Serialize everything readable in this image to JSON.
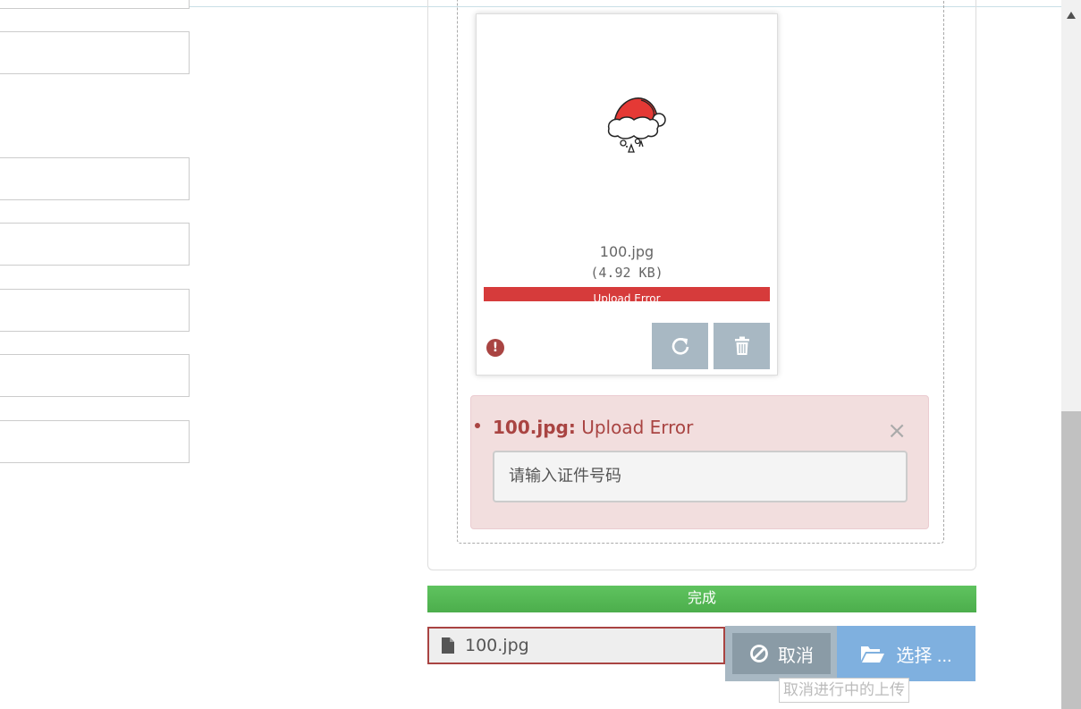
{
  "thumbnail": {
    "file_name": "100.jpg",
    "file_size": "(4.92 KB)",
    "progress_label": "Upload Error",
    "progress": 1.0,
    "image_icon": "santa-hat-icon",
    "retry_icon": "refresh-icon",
    "delete_icon": "trash-icon",
    "status_icon": "exclamation-circle-icon"
  },
  "error": {
    "file": "100.jpg:",
    "message": "Upload Error",
    "close": "×",
    "input_placeholder": "请输入证件号码"
  },
  "progress_main": {
    "label": "完成",
    "progress": 1.0
  },
  "caption": {
    "value": "100.jpg",
    "icon": "file-icon"
  },
  "buttons": {
    "cancel": "取消",
    "cancel_icon": "ban-icon",
    "select": "选择 ...",
    "select_icon": "folder-open-icon",
    "cancel_tooltip": "取消进行中的上传"
  },
  "colors": {
    "error_text": "#a94442",
    "error_bg": "#f2dede",
    "success": "#5cb85c",
    "primary_button": "#7fb0df",
    "secondary_button": "#8a9ba6"
  }
}
